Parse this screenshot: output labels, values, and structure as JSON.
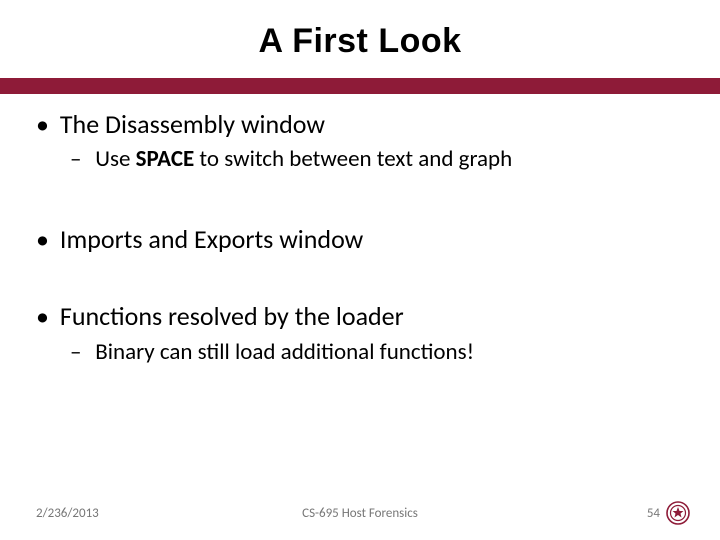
{
  "slide": {
    "title": "A First Look",
    "accent_color": "#8e1b38",
    "bullets": {
      "b1": "The Disassembly window",
      "b1_1_pre": "Use ",
      "b1_1_bold": "SPACE",
      "b1_1_post": " to switch between text and graph",
      "b2": "Imports and Exports window",
      "b3": "Functions resolved by the loader",
      "b3_1": "Binary can still load additional functions!"
    }
  },
  "footer": {
    "date": "2/236/2013",
    "center": "CS-695 Host Forensics",
    "page_number": "54"
  }
}
